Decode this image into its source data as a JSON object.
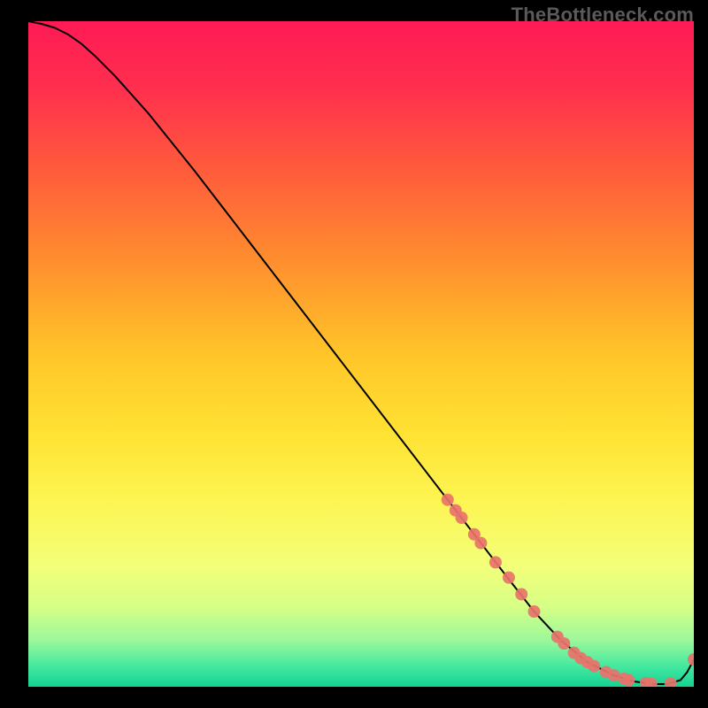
{
  "watermark": "TheBottleneck.com",
  "chart_data": {
    "type": "line",
    "title": "",
    "xlabel": "",
    "ylabel": "",
    "xlim": [
      0,
      100
    ],
    "ylim": [
      0,
      100
    ],
    "grid": false,
    "legend": false,
    "gradient_stops": [
      {
        "offset": 0,
        "color": "#ff1a55"
      },
      {
        "offset": 10,
        "color": "#ff2f4e"
      },
      {
        "offset": 22,
        "color": "#ff5a3c"
      },
      {
        "offset": 35,
        "color": "#ff8a2f"
      },
      {
        "offset": 50,
        "color": "#ffc529"
      },
      {
        "offset": 62,
        "color": "#ffe233"
      },
      {
        "offset": 72,
        "color": "#fdf552"
      },
      {
        "offset": 82,
        "color": "#f3ff7a"
      },
      {
        "offset": 88,
        "color": "#d6ff86"
      },
      {
        "offset": 93,
        "color": "#9cf89b"
      },
      {
        "offset": 97,
        "color": "#43e8a0"
      },
      {
        "offset": 100,
        "color": "#13d392"
      }
    ],
    "series": [
      {
        "name": "bottleneck-curve",
        "color": "#000000",
        "x": [
          0,
          2,
          4,
          6,
          8,
          10,
          13,
          18,
          25,
          35,
          45,
          55,
          63,
          68,
          72,
          76,
          80,
          84,
          88,
          91,
          94,
          96,
          98,
          99,
          100
        ],
        "y": [
          100,
          99.6,
          99.0,
          98.0,
          96.6,
          94.8,
          91.8,
          86.2,
          77.5,
          64.5,
          51.5,
          38.5,
          28.1,
          21.6,
          16.4,
          11.3,
          7.0,
          3.7,
          1.7,
          0.8,
          0.4,
          0.4,
          1.0,
          2.2,
          4.1
        ]
      }
    ],
    "markers": {
      "name": "highlight-points",
      "color": "#e8736b",
      "radius": 7,
      "x": [
        63.0,
        64.2,
        65.1,
        67.0,
        68.0,
        70.2,
        72.2,
        74.1,
        76.0,
        79.5,
        80.5,
        82.0,
        83.0,
        84.0,
        85.0,
        86.8,
        88.0,
        89.5,
        90.2,
        92.8,
        93.6,
        96.5,
        100.0
      ],
      "y": [
        28.1,
        26.5,
        25.4,
        22.9,
        21.6,
        18.7,
        16.4,
        13.9,
        11.3,
        7.5,
        6.5,
        5.1,
        4.3,
        3.7,
        3.1,
        2.2,
        1.7,
        1.2,
        1.0,
        0.55,
        0.45,
        0.5,
        4.1
      ]
    }
  }
}
